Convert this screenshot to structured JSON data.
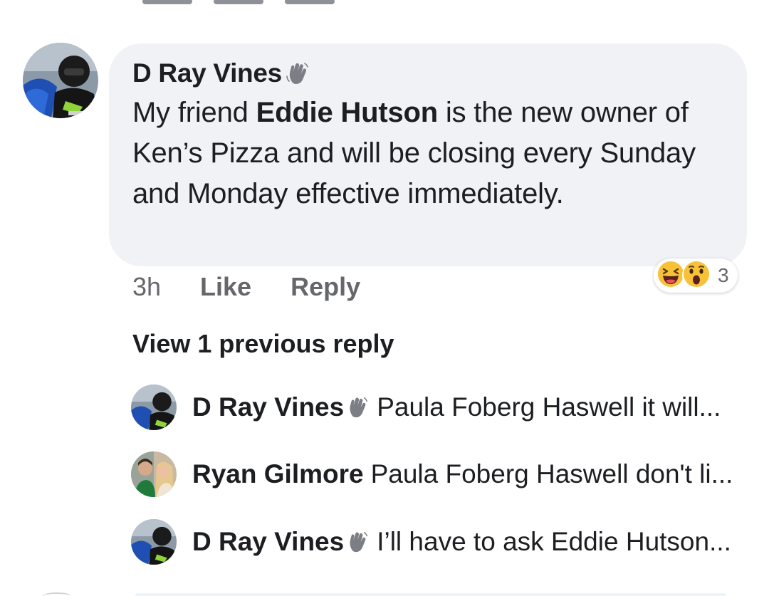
{
  "comment": {
    "author": "D Ray Vines",
    "text_before": "My friend ",
    "mention": "Eddie Hutson",
    "text_after": " is the new owner of Ken’s Pizza and will be closing every Sunday and Monday effective immediately.",
    "time": "3h",
    "like_label": "Like",
    "reply_label": "Reply",
    "reaction_count": "3",
    "reactions": [
      "haha-icon",
      "wow-icon"
    ]
  },
  "thread": {
    "view_previous_label": "View 1 previous reply",
    "replies": [
      {
        "author": "D Ray Vines",
        "has_wave": true,
        "text": "Paula Foberg Haswell it will..."
      },
      {
        "author": "Ryan Gilmore",
        "has_wave": false,
        "text": "Paula Foberg Haswell don't li..."
      },
      {
        "author": "D Ray Vines",
        "has_wave": true,
        "text": "I’ll have to ask Eddie Hutson..."
      }
    ]
  },
  "colors": {
    "bubble": "#f0f2f5",
    "meta_text": "#65676b",
    "primary_text": "#1c1e21"
  }
}
